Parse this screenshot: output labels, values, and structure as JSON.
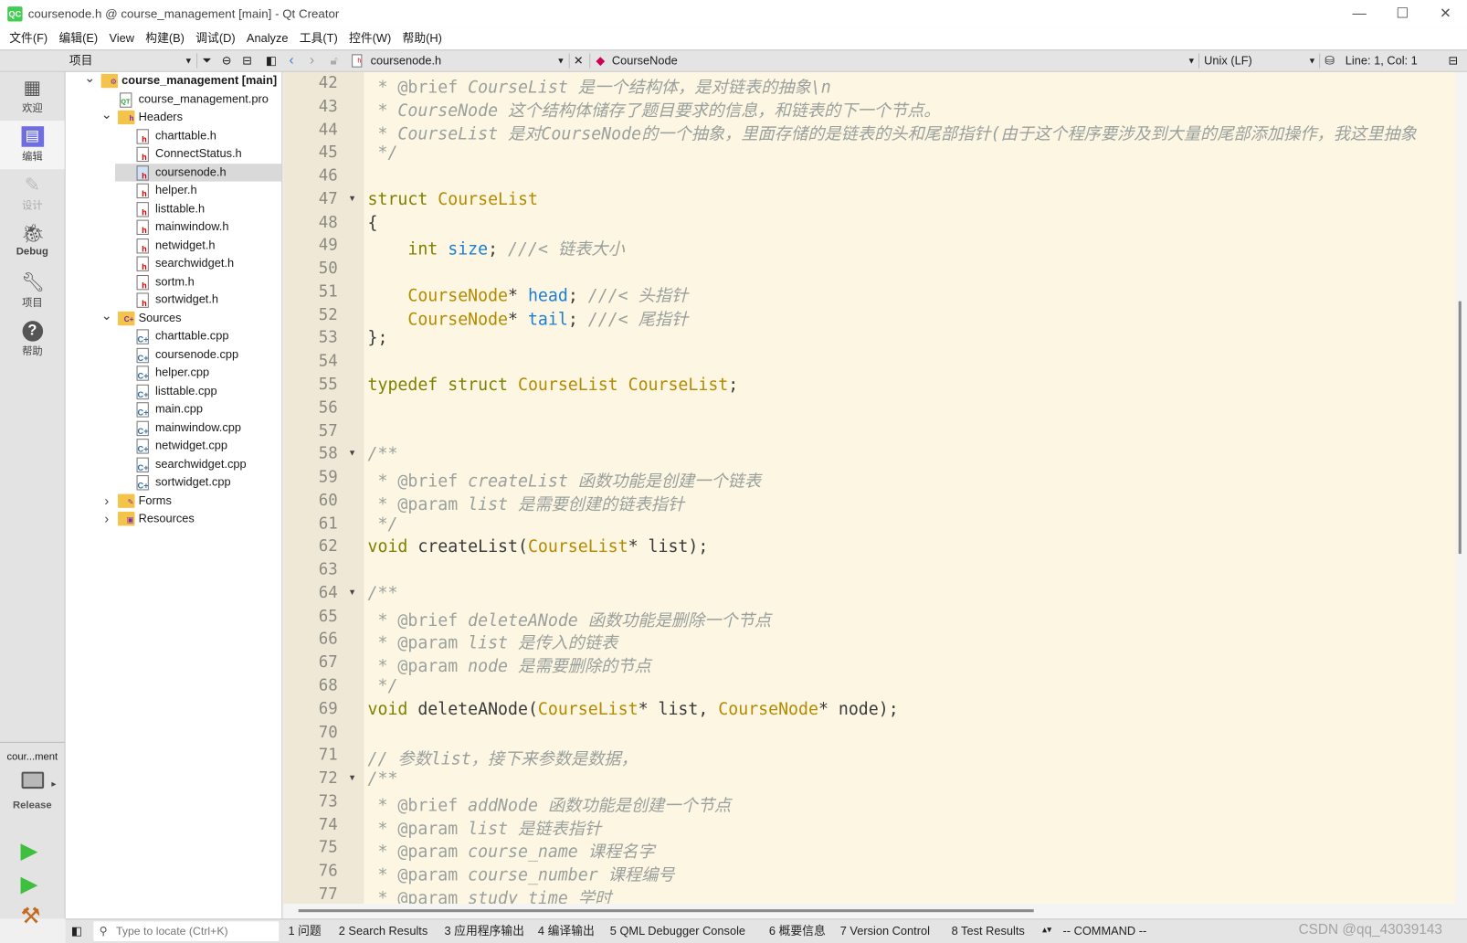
{
  "window": {
    "title": "coursenode.h @ course_management [main] - Qt Creator",
    "app_icon": "QC",
    "minimize": "—",
    "maximize": "☐",
    "close": "✕"
  },
  "menu": [
    "文件(F)",
    "编辑(E)",
    "View",
    "构建(B)",
    "调试(D)",
    "Analyze",
    "工具(T)",
    "控件(W)",
    "帮助(H)"
  ],
  "toolbar": {
    "panel_label": "项目",
    "file_name": "coursenode.h",
    "symbol": "CourseNode",
    "line_ending": "Unix (LF)",
    "cursor_pos": "Line: 1, Col: 1"
  },
  "modes": [
    {
      "label": "欢迎",
      "icon": "grid-icon"
    },
    {
      "label": "编辑",
      "icon": "edit-icon"
    },
    {
      "label": "设计",
      "icon": "pencil-icon"
    },
    {
      "label": "Debug",
      "icon": "bug-icon"
    },
    {
      "label": "项目",
      "icon": "wrench-icon"
    },
    {
      "label": "帮助",
      "icon": "help-icon"
    }
  ],
  "kit": {
    "project": "cour...ment",
    "build": "Release"
  },
  "tree": [
    {
      "label": "course_management [main]",
      "depth": 0,
      "type": "project",
      "expanded": true
    },
    {
      "label": "course_management.pro",
      "depth": 1,
      "type": "pro"
    },
    {
      "label": "Headers",
      "depth": 1,
      "type": "folder-h",
      "expanded": true
    },
    {
      "label": "charttable.h",
      "depth": 2,
      "type": "h"
    },
    {
      "label": "ConnectStatus.h",
      "depth": 2,
      "type": "h"
    },
    {
      "label": "coursenode.h",
      "depth": 2,
      "type": "h",
      "selected": true
    },
    {
      "label": "helper.h",
      "depth": 2,
      "type": "h"
    },
    {
      "label": "listtable.h",
      "depth": 2,
      "type": "h"
    },
    {
      "label": "mainwindow.h",
      "depth": 2,
      "type": "h"
    },
    {
      "label": "netwidget.h",
      "depth": 2,
      "type": "h"
    },
    {
      "label": "searchwidget.h",
      "depth": 2,
      "type": "h"
    },
    {
      "label": "sortm.h",
      "depth": 2,
      "type": "h"
    },
    {
      "label": "sortwidget.h",
      "depth": 2,
      "type": "h"
    },
    {
      "label": "Sources",
      "depth": 1,
      "type": "folder-c",
      "expanded": true
    },
    {
      "label": "charttable.cpp",
      "depth": 2,
      "type": "c"
    },
    {
      "label": "coursenode.cpp",
      "depth": 2,
      "type": "c"
    },
    {
      "label": "helper.cpp",
      "depth": 2,
      "type": "c"
    },
    {
      "label": "listtable.cpp",
      "depth": 2,
      "type": "c"
    },
    {
      "label": "main.cpp",
      "depth": 2,
      "type": "c"
    },
    {
      "label": "mainwindow.cpp",
      "depth": 2,
      "type": "c"
    },
    {
      "label": "netwidget.cpp",
      "depth": 2,
      "type": "c"
    },
    {
      "label": "searchwidget.cpp",
      "depth": 2,
      "type": "c"
    },
    {
      "label": "sortwidget.cpp",
      "depth": 2,
      "type": "c"
    },
    {
      "label": "Forms",
      "depth": 1,
      "type": "folder-f",
      "expanded": false
    },
    {
      "label": "Resources",
      "depth": 1,
      "type": "folder-r",
      "expanded": false
    }
  ],
  "code": {
    "first_line": 42,
    "fold_lines": [
      47,
      58,
      64,
      72
    ],
    "lines": [
      [
        [
          " * ",
          "dc"
        ],
        [
          "@brief",
          "dc"
        ],
        [
          " CourseList 是一个结构体，是对链表的抽象\\n",
          "cm"
        ]
      ],
      [
        [
          " * CourseNode 这个结构体储存了题目要求的信息，和链表的下一个节点。",
          "cm"
        ]
      ],
      [
        [
          " * CourseList 是对CourseNode的一个抽象，里面存储的是链表的头和尾部指针(由于这个程序要涉及到大量的尾部添加操作，我这里抽象",
          "cm"
        ]
      ],
      [
        [
          " */",
          "cm"
        ]
      ],
      [],
      [
        [
          "struct ",
          "kw"
        ],
        [
          "CourseList",
          "ty"
        ]
      ],
      [
        [
          "{",
          "pl"
        ]
      ],
      [
        [
          "    ",
          "pl"
        ],
        [
          "int",
          "kw"
        ],
        [
          " ",
          "pl"
        ],
        [
          "size",
          "fld"
        ],
        [
          "; ",
          "pl"
        ],
        [
          "///< 链表大小",
          "cm"
        ]
      ],
      [],
      [
        [
          "    ",
          "pl"
        ],
        [
          "CourseNode",
          "ty"
        ],
        [
          "* ",
          "pl"
        ],
        [
          "head",
          "fld"
        ],
        [
          "; ",
          "pl"
        ],
        [
          "///< 头指针",
          "cm"
        ]
      ],
      [
        [
          "    ",
          "pl"
        ],
        [
          "CourseNode",
          "ty"
        ],
        [
          "* ",
          "pl"
        ],
        [
          "tail",
          "fld"
        ],
        [
          "; ",
          "pl"
        ],
        [
          "///< 尾指针",
          "cm"
        ]
      ],
      [
        [
          "};",
          "pl"
        ]
      ],
      [],
      [
        [
          "typedef ",
          "kw"
        ],
        [
          "struct ",
          "kw"
        ],
        [
          "CourseList ",
          "ty"
        ],
        [
          "CourseList",
          "ty"
        ],
        [
          ";",
          "pl"
        ]
      ],
      [],
      [],
      [
        [
          "/**",
          "cm"
        ]
      ],
      [
        [
          " * ",
          "cm"
        ],
        [
          "@brief",
          "dc"
        ],
        [
          " createList 函数功能是创建一个链表",
          "cm"
        ]
      ],
      [
        [
          " * ",
          "cm"
        ],
        [
          "@param",
          "dc"
        ],
        [
          " list 是需要创建的链表指针",
          "cm"
        ]
      ],
      [
        [
          " */",
          "cm"
        ]
      ],
      [
        [
          "void ",
          "kw"
        ],
        [
          "createList(",
          "pl"
        ],
        [
          "CourseList",
          "ty"
        ],
        [
          "* list);",
          "pl"
        ]
      ],
      [],
      [
        [
          "/**",
          "cm"
        ]
      ],
      [
        [
          " * ",
          "cm"
        ],
        [
          "@brief",
          "dc"
        ],
        [
          " deleteANode 函数功能是删除一个节点",
          "cm"
        ]
      ],
      [
        [
          " * ",
          "cm"
        ],
        [
          "@param",
          "dc"
        ],
        [
          " list 是传入的链表",
          "cm"
        ]
      ],
      [
        [
          " * ",
          "cm"
        ],
        [
          "@param",
          "dc"
        ],
        [
          " node 是需要删除的节点",
          "cm"
        ]
      ],
      [
        [
          " */",
          "cm"
        ]
      ],
      [
        [
          "void ",
          "kw"
        ],
        [
          "deleteANode(",
          "pl"
        ],
        [
          "CourseList",
          "ty"
        ],
        [
          "* list, ",
          "pl"
        ],
        [
          "CourseNode",
          "ty"
        ],
        [
          "* node);",
          "pl"
        ]
      ],
      [],
      [
        [
          "// 参数list，接下来参数是数据，",
          "cm"
        ]
      ],
      [
        [
          "/**",
          "cm"
        ]
      ],
      [
        [
          " * ",
          "cm"
        ],
        [
          "@brief",
          "dc"
        ],
        [
          " addNode 函数功能是创建一个节点",
          "cm"
        ]
      ],
      [
        [
          " * ",
          "cm"
        ],
        [
          "@param",
          "dc"
        ],
        [
          " list 是链表指针",
          "cm"
        ]
      ],
      [
        [
          " * ",
          "cm"
        ],
        [
          "@param",
          "dc"
        ],
        [
          " course_name 课程名字",
          "cm"
        ]
      ],
      [
        [
          " * ",
          "cm"
        ],
        [
          "@param",
          "dc"
        ],
        [
          " course_number 课程编号",
          "cm"
        ]
      ],
      [
        [
          " * ",
          "cm"
        ],
        [
          "@param",
          "dc"
        ],
        [
          " study_time 学时",
          "cm"
        ]
      ]
    ]
  },
  "colors": {
    "keyword": "#808000",
    "type": "#b38a00",
    "field": "#1b7fd1",
    "comment": "#9aa09c",
    "editor_bg": "#fdf6e3"
  },
  "statusbar": {
    "locate_placeholder": "Type to locate (Ctrl+K)",
    "panes": [
      "1 问题",
      "2 Search Results",
      "3 应用程序输出",
      "4 编译输出",
      "5 QML Debugger Console",
      "6 概要信息",
      "7 Version Control",
      "8 Test Results"
    ],
    "mode": "-- COMMAND --"
  },
  "watermark": "CSDN @qq_43039143"
}
